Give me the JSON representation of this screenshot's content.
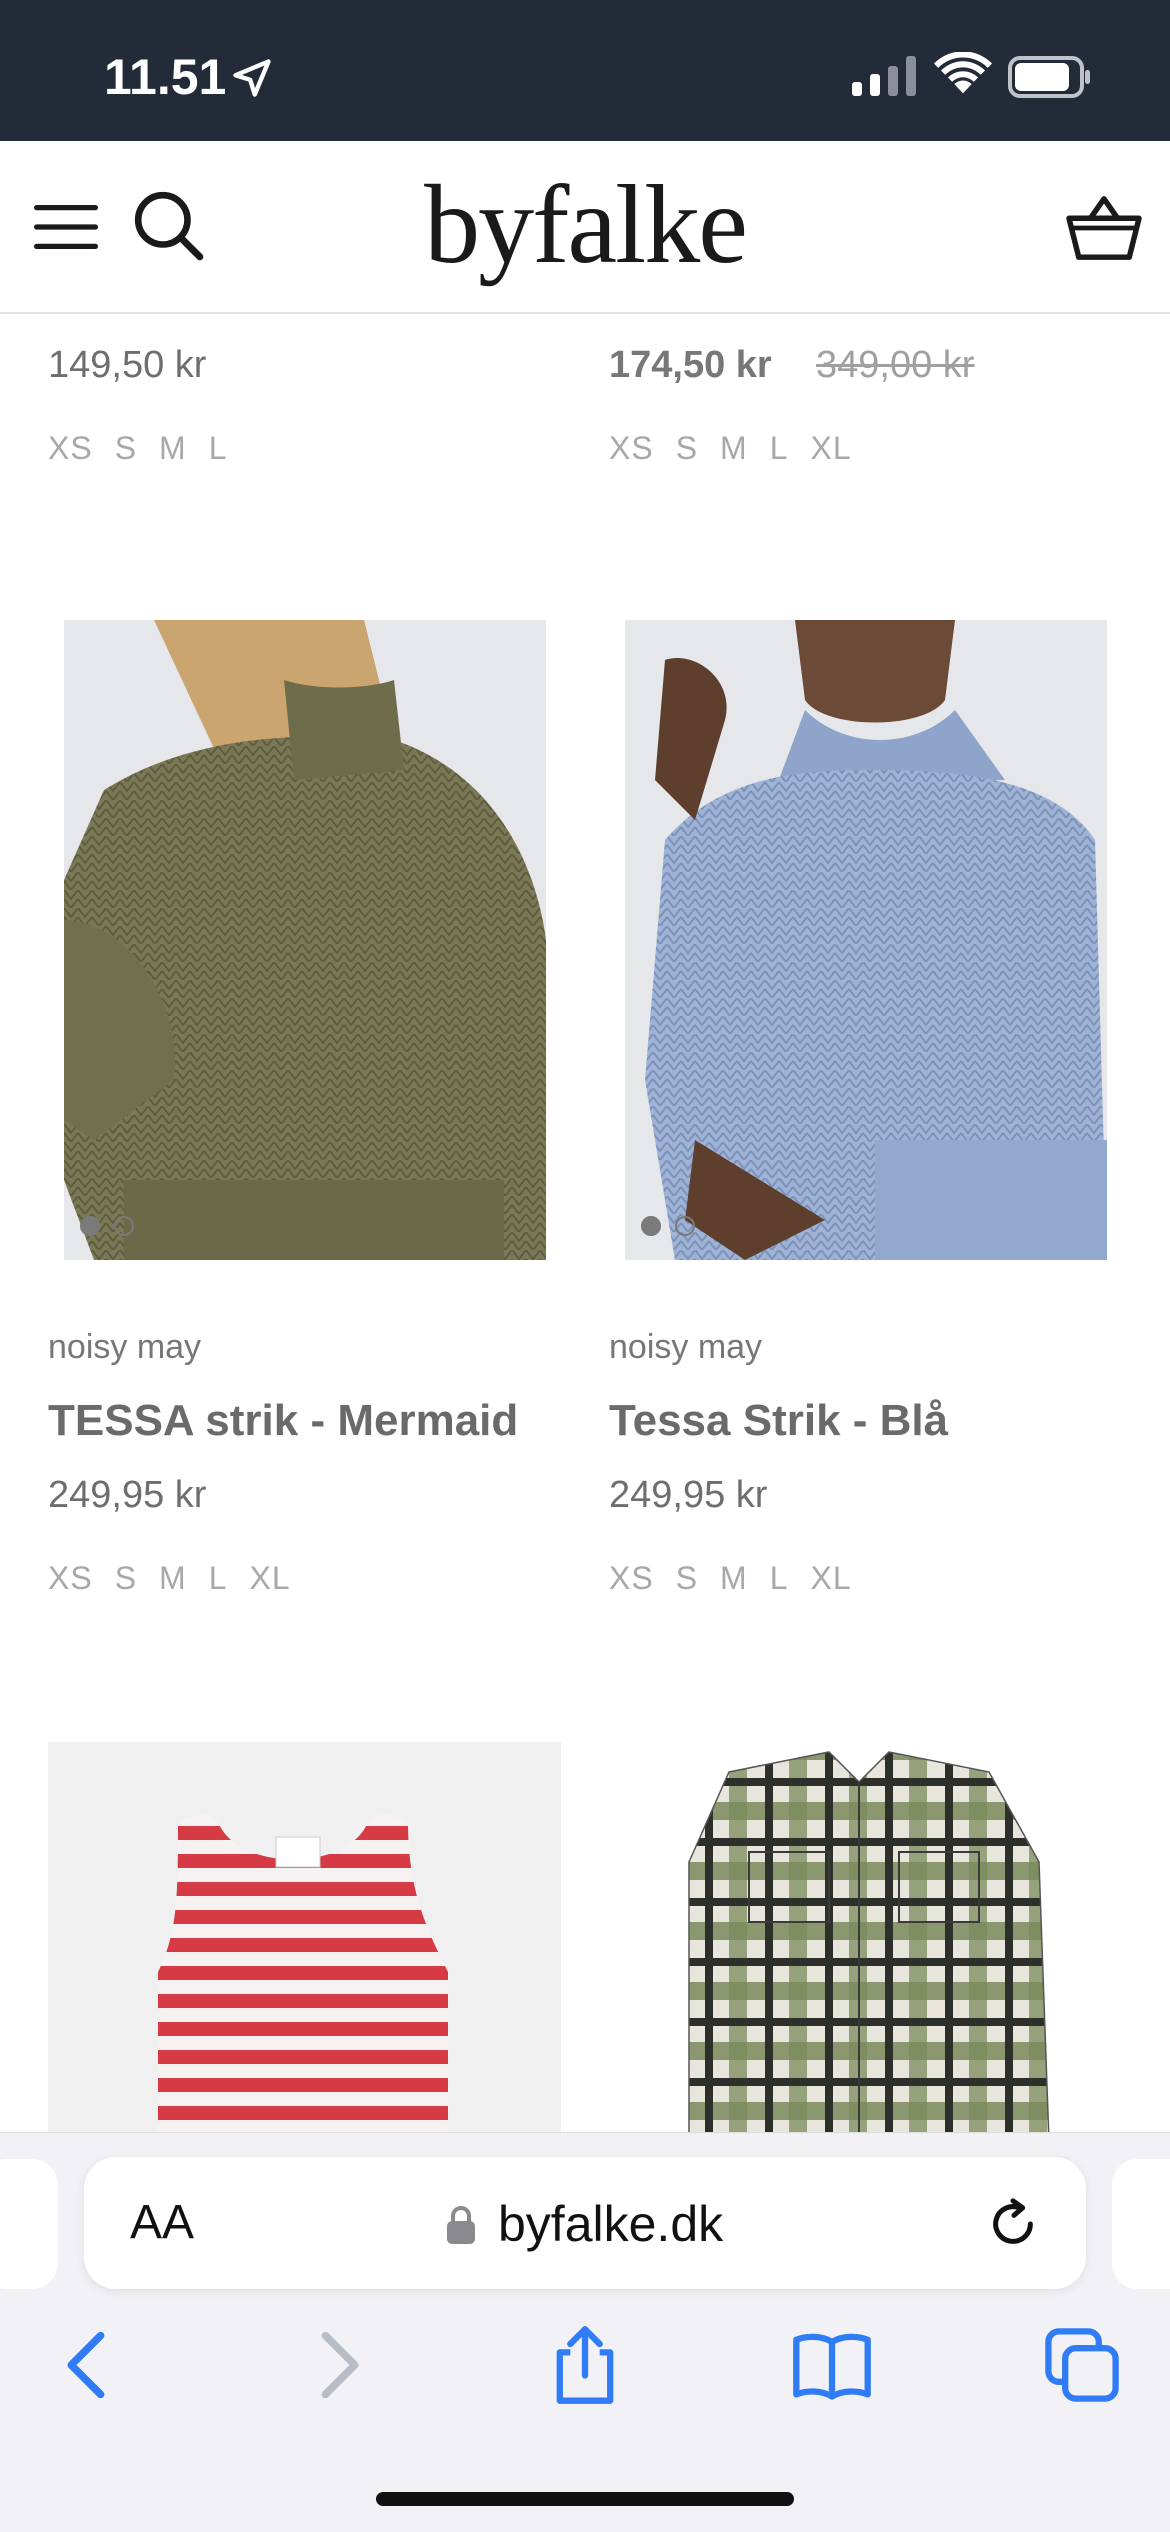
{
  "status_bar": {
    "time": "11.51"
  },
  "header": {
    "logo": "byfalke"
  },
  "previous_row": {
    "left": {
      "price": "149,50 kr",
      "sizes": [
        "XS",
        "S",
        "M",
        "L"
      ]
    },
    "right": {
      "sale_price": "174,50 kr",
      "old_price": "349,00 kr",
      "sizes": [
        "XS",
        "S",
        "M",
        "L",
        "XL"
      ]
    }
  },
  "products": [
    {
      "brand": "noisy may",
      "title": "TESSA strik - Mermaid",
      "price": "249,95 kr",
      "sizes": [
        "XS",
        "S",
        "M",
        "L",
        "XL"
      ],
      "image_color": "#7f7d5b",
      "image_slide": 1,
      "image_slides": 2
    },
    {
      "brand": "noisy may",
      "title": "Tessa Strik - Blå",
      "price": "249,95 kr",
      "sizes": [
        "XS",
        "S",
        "M",
        "L",
        "XL"
      ],
      "image_color": "#9db2d4",
      "image_slide": 1,
      "image_slides": 2
    }
  ],
  "safari": {
    "text_size_label": "AA",
    "address": "byfalke.dk"
  },
  "colors": {
    "status_bar": "#232a38",
    "safari_blue": "#2f7cf6"
  }
}
